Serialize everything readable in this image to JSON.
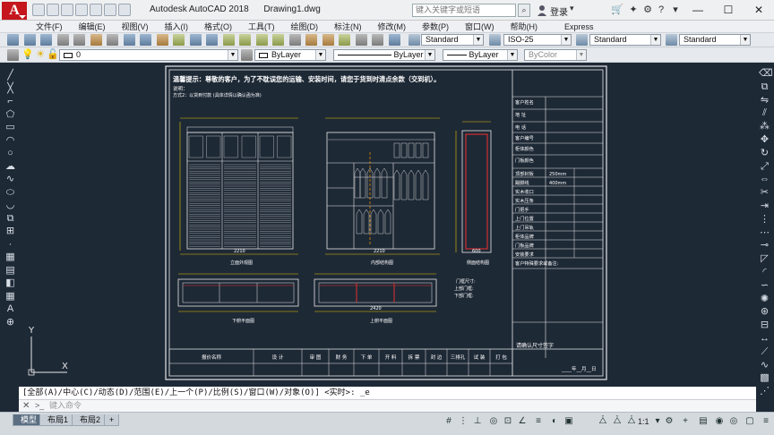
{
  "window": {
    "app_title": "Autodesk AutoCAD 2018",
    "file_title": "Drawing1.dwg",
    "search_placeholder": "键入关键字或短语",
    "login_label": "登录",
    "minimize": "—",
    "maximize": "☐",
    "close": "✕"
  },
  "menu": {
    "items": [
      "文件(F)",
      "编辑(E)",
      "视图(V)",
      "插入(I)",
      "格式(O)",
      "工具(T)",
      "绘图(D)",
      "标注(N)",
      "修改(M)",
      "参数(P)",
      "窗口(W)",
      "帮助(H)",
      "Express"
    ]
  },
  "toolbar": {
    "text_style": "Standard",
    "dim_style": "ISO-25",
    "table_style": "Standard",
    "multileader_style": "Standard",
    "layer": "0",
    "color": "ByLayer",
    "linetype": "ByLayer",
    "lineweight": "ByLayer",
    "plot_style": "ByColor"
  },
  "drawing": {
    "notice_line1": "温馨提示：尊敬的客户，为了不耽误您的运输、安装时间，请您于货到时清点余款（交到机）。",
    "notice_line2": "说明：",
    "notice_line3": "方式2：以货到付款  (具体详情以确认函为准)",
    "labels": {
      "front_view": "立面外观图",
      "inner_view": "内部结构图",
      "side_view": "侧面结构图",
      "plan_lower": "下俯平面图",
      "plan_upper": "上俯平面图",
      "door_size": "门框尺寸:",
      "top_thickness": "上部门框:",
      "bottom_thickness": "下部门框:"
    },
    "right_table": {
      "rows": [
        "客户姓名",
        "地  址",
        "电  话",
        "客户编号",
        "柜体颜色",
        "门板颜色",
        "顶部封板",
        "踢脚线",
        "实木收口",
        "实木压条",
        "门把手",
        "上门位置",
        "上门吊轨",
        "柜体品牌",
        "门板品牌",
        "安装要求",
        "客户特殊要求或备注:"
      ],
      "values": [
        "",
        "",
        "",
        "",
        "",
        "",
        "250mm",
        "400mm",
        "",
        "",
        "",
        "",
        "",
        "",
        "",
        "",
        ""
      ]
    },
    "bottom_table": {
      "headers": [
        "报价名称",
        "设  计",
        "审  图",
        "财  务",
        "下  单",
        "开  料",
        "拆  票",
        "封  边",
        "三排孔",
        "试  装",
        "打  包"
      ],
      "confirm_label": "请确认尺寸签字",
      "date_label": "____年__月__日"
    },
    "dimensions": {
      "front_width": "2210",
      "front_height": "2400",
      "inner_width": "2210",
      "side_width": "600",
      "plan_width": "2420"
    }
  },
  "command": {
    "history": "[全部(A)/中心(C)/动态(D)/范围(E)/上一个(P)/比例(S)/窗口(W)/对象(O)] <实时>: _e",
    "prompt": ">_",
    "placeholder": "键入命令"
  },
  "status": {
    "tabs": [
      "模型",
      "布局1",
      "布局2",
      "+"
    ],
    "scale": "1:1",
    "ucs_y": "Y",
    "ucs_x": "X"
  }
}
